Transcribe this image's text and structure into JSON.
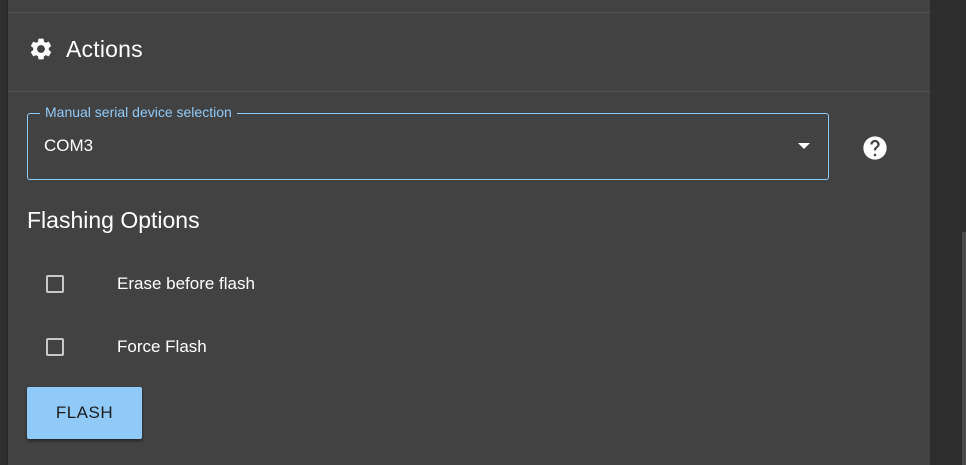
{
  "header": {
    "icon": "gear-icon",
    "title": "Actions"
  },
  "serial_select": {
    "label": "Manual serial device selection",
    "value": "COM3",
    "dropdown_icon": "chevron-down-icon",
    "help_icon": "help-circle-icon"
  },
  "flashing_options": {
    "title": "Flashing Options",
    "options": [
      {
        "label": "Erase before flash",
        "checked": false
      },
      {
        "label": "Force Flash",
        "checked": false
      }
    ]
  },
  "flash_button": {
    "label": "FLASH"
  },
  "colors": {
    "panel": "#424242",
    "accent": "#90caf9",
    "text": "#ffffff"
  }
}
